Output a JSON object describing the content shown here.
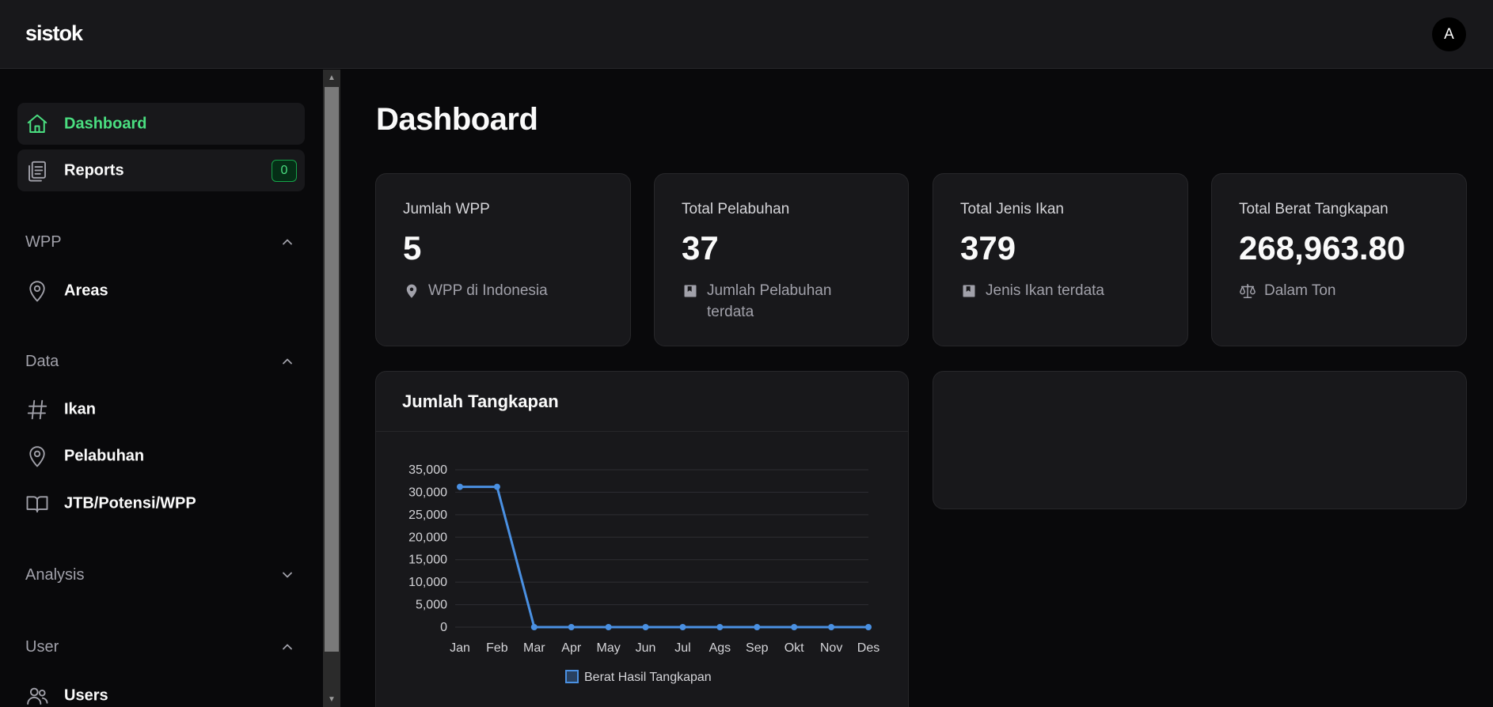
{
  "app": {
    "brand": "sistok",
    "avatar_initial": "A"
  },
  "sidebar": {
    "items": [
      {
        "label": "Dashboard",
        "icon": "home-icon",
        "active": true
      },
      {
        "label": "Reports",
        "icon": "clipboard-list-icon",
        "badge": "0"
      }
    ],
    "sections": [
      {
        "title": "WPP",
        "expanded": true,
        "items": [
          {
            "label": "Areas",
            "icon": "map-pin-icon"
          }
        ]
      },
      {
        "title": "Data",
        "expanded": true,
        "items": [
          {
            "label": "Ikan",
            "icon": "hash-icon"
          },
          {
            "label": "Pelabuhan",
            "icon": "map-pin-icon"
          },
          {
            "label": "JTB/Potensi/WPP",
            "icon": "book-open-icon"
          }
        ]
      },
      {
        "title": "Analysis",
        "expanded": false,
        "items": []
      },
      {
        "title": "User",
        "expanded": true,
        "items": [
          {
            "label": "Users",
            "icon": "users-icon"
          }
        ]
      }
    ]
  },
  "main": {
    "title": "Dashboard",
    "stats": [
      {
        "title": "Jumlah WPP",
        "value": "5",
        "sub": "WPP di Indonesia",
        "icon": "map-pin-icon"
      },
      {
        "title": "Total Pelabuhan",
        "value": "37",
        "sub": "Jumlah Pelabuhan terdata",
        "icon": "bookmark-book-icon"
      },
      {
        "title": "Total Jenis Ikan",
        "value": "379",
        "sub": "Jenis Ikan terdata",
        "icon": "bookmark-book-icon"
      },
      {
        "title": "Total Berat Tangkapan",
        "value": "268,963.80",
        "sub": "Dalam Ton",
        "icon": "scale-icon"
      }
    ],
    "chart_card_title": "Jumlah Tangkapan"
  },
  "colors": {
    "accent": "#4ade80",
    "line": "#4a90e2",
    "card": "#18181b",
    "background": "#09090b"
  },
  "chart_data": {
    "type": "line",
    "title": "",
    "categories": [
      "Jan",
      "Feb",
      "Mar",
      "Apr",
      "May",
      "Jun",
      "Jul",
      "Ags",
      "Sep",
      "Okt",
      "Nov",
      "Des"
    ],
    "series": [
      {
        "name": "Berat Hasil Tangkapan",
        "values": [
          31200,
          31200,
          0,
          0,
          0,
          0,
          0,
          0,
          0,
          0,
          0,
          0
        ]
      }
    ],
    "yticks": [
      "35,000",
      "30,000",
      "25,000",
      "20,000",
      "15,000",
      "10,000",
      "5,000",
      "0"
    ],
    "ylim": [
      0,
      35000
    ],
    "xlabel": "",
    "ylabel": "",
    "grid": true,
    "legend": "bottom"
  }
}
